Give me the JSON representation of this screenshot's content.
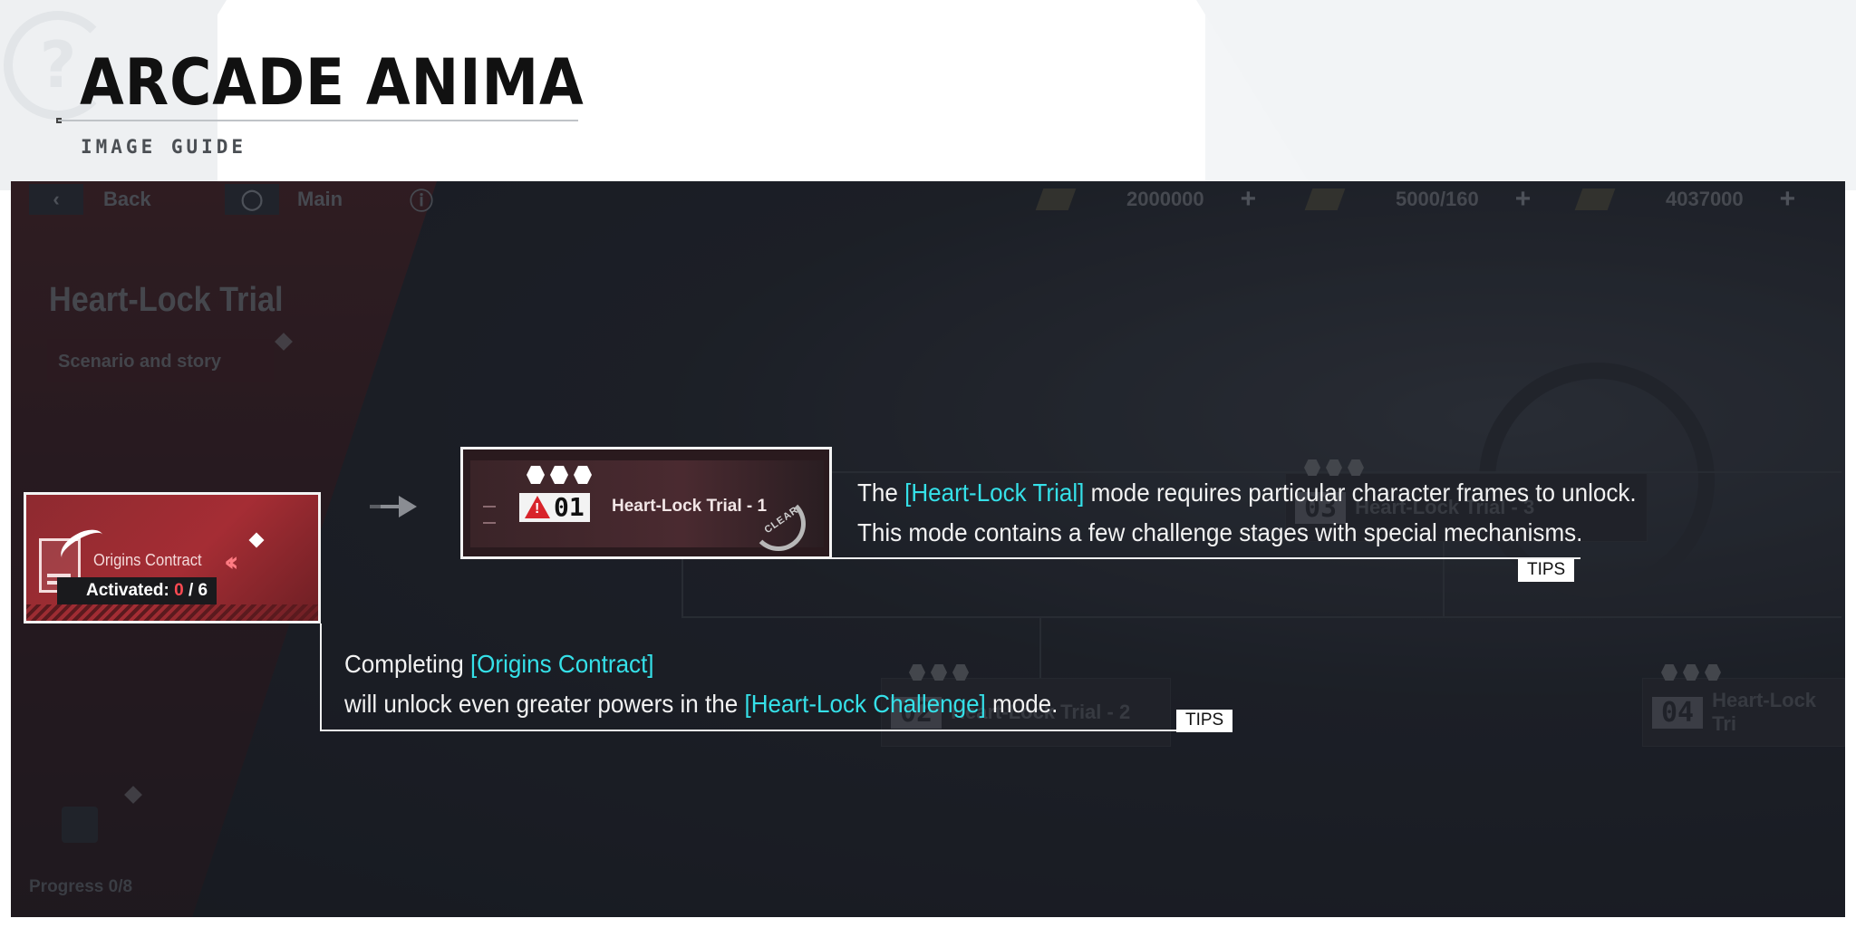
{
  "guide": {
    "title": "ARCADE ANIMA",
    "subtitle": "IMAGE GUIDE"
  },
  "game": {
    "topbar": {
      "back_label": "Back",
      "main_label": "Main",
      "resources": [
        "2000000",
        "5000/160",
        "4037000"
      ]
    },
    "mode_title": "Heart-Lock Trial",
    "mode_subtitle": "Scenario and story",
    "contract": {
      "title": "Origins Contract",
      "activated_label": "Activated:",
      "activated_current": "0",
      "activated_total": "/ 6"
    },
    "stage": {
      "number": "01",
      "name": "Heart-Lock Trial - 1",
      "status": "CLEAR"
    },
    "ghost_stages": [
      {
        "number": "03",
        "name": "Heart-Lock Trial - 3"
      },
      {
        "number": "02",
        "name": "Heart-Lock Trial - 2"
      },
      {
        "number": "04",
        "name": "Heart-Lock Tri"
      }
    ],
    "progress": "Progress 0/8"
  },
  "tips": [
    {
      "badge": "TIPS",
      "line1_pre": "The ",
      "line1_hl": "[Heart-Lock Trial]",
      "line1_post": " mode requires particular character frames to unlock.",
      "line2": "This mode contains a few challenge stages with special mechanisms."
    },
    {
      "badge": "TIPS",
      "line1_pre": "Completing ",
      "line1_hl": "[Origins Contract]",
      "line2_pre": "will unlock even greater powers in the ",
      "line2_hl": "[Heart-Lock Challenge]",
      "line2_post": " mode."
    }
  ],
  "colors": {
    "highlight": "#35e0e8",
    "danger": "#d8242b",
    "card_red": "#a52d34"
  }
}
